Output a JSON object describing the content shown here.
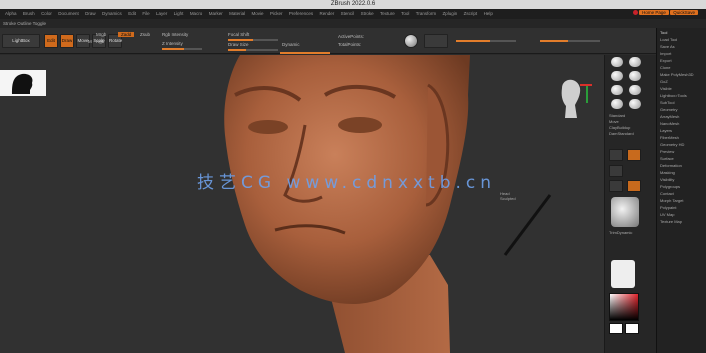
{
  "app": {
    "title": "ZBrush 2022.0.6"
  },
  "menubar": {
    "items": [
      "Alpha",
      "Brush",
      "Color",
      "Document",
      "Draw",
      "Dynamics",
      "Edit",
      "File",
      "Layer",
      "Light",
      "Macro",
      "Marker",
      "Material",
      "Movie",
      "Picker",
      "Preferences",
      "Render",
      "Stencil",
      "Stroke",
      "Texture",
      "Tool",
      "Transform",
      "Zplugin",
      "Zscript",
      "Help"
    ],
    "home_label": "Home Page",
    "quicksave_label": "QuickSave"
  },
  "subbar": {
    "label": "Stroke Outline Toggle"
  },
  "toolbar": {
    "lightbox": "LightBox",
    "edit": "Edit",
    "draw": "Draw",
    "move": "Move",
    "scale": "Scale",
    "rotate": "Rotate",
    "zadd": "Zadd",
    "zsub": "Zsub",
    "mrgb": "Mrgb",
    "rgb": "Rgb",
    "m": "M",
    "rgb_intensity": "Rgb Intensity",
    "z_intensity": "Z Intensity",
    "focal_shift": "Focal Shift",
    "draw_size": "Draw Size",
    "dynamic": "Dynamic",
    "active_points": "ActivePoints:",
    "total_points": "TotalPoints:"
  },
  "viewport": {
    "watermark": "技艺CG  www.cdnxxtb.cn",
    "note_line1": "Head",
    "note_line2": "Sculpted"
  },
  "right_panel": {
    "labels": [
      "Standard",
      "Move",
      "ClayBuildup",
      "DamStandard",
      "TrimDynamic",
      "hPolish",
      "Inflate",
      "Pinch"
    ]
  },
  "tray": {
    "header": "Tool",
    "rows": [
      "Load Tool",
      "Save As",
      "Import",
      "Export",
      "Clone",
      "Make PolyMesh3D",
      "GoZ",
      "Visible",
      "Lightbox>Tools",
      "SubTool",
      "Geometry",
      "ArrayMesh",
      "NanoMesh",
      "Layers",
      "FiberMesh",
      "Geometry HD",
      "Preview",
      "Surface",
      "Deformation",
      "Masking",
      "Visibility",
      "Polygroups",
      "Contact",
      "Morph Target",
      "Polypaint",
      "UV Map",
      "Texture Map"
    ]
  },
  "colors": {
    "accent": "#e0701e",
    "skin": "#b86a45",
    "viewport_bg": "#313131",
    "watermark": "#6ea0ea"
  }
}
